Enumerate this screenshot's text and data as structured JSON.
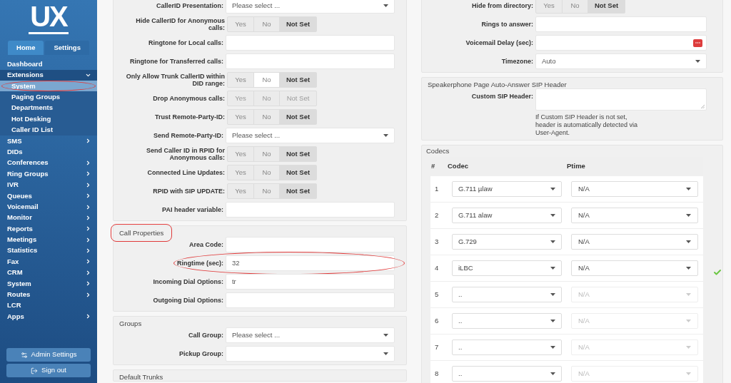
{
  "sidebar": {
    "logo": "UX",
    "tabs": [
      {
        "label": "Home",
        "selected": true
      },
      {
        "label": "Settings",
        "selected": false
      }
    ],
    "items": [
      {
        "label": "Dashboard",
        "selected": false,
        "has_arrow": false
      },
      {
        "label": "Extensions",
        "selected": false,
        "has_arrow": true,
        "expanded": true,
        "children": [
          {
            "label": "System",
            "selected": true
          },
          {
            "label": "Paging Groups",
            "selected": false
          },
          {
            "label": "Departments",
            "selected": false
          },
          {
            "label": "Hot Desking",
            "selected": false
          },
          {
            "label": "Caller ID List",
            "selected": false
          }
        ]
      },
      {
        "label": "SMS",
        "selected": false,
        "has_arrow": true
      },
      {
        "label": "DIDs",
        "selected": false,
        "has_arrow": false
      },
      {
        "label": "Conferences",
        "selected": false,
        "has_arrow": true
      },
      {
        "label": "Ring Groups",
        "selected": false,
        "has_arrow": true
      },
      {
        "label": "IVR",
        "selected": false,
        "has_arrow": true
      },
      {
        "label": "Queues",
        "selected": false,
        "has_arrow": true
      },
      {
        "label": "Voicemail",
        "selected": false,
        "has_arrow": true
      },
      {
        "label": "Monitor",
        "selected": false,
        "has_arrow": true
      },
      {
        "label": "Reports",
        "selected": false,
        "has_arrow": true
      },
      {
        "label": "Meetings",
        "selected": false,
        "has_arrow": true
      },
      {
        "label": "Statistics",
        "selected": false,
        "has_arrow": true
      },
      {
        "label": "Fax",
        "selected": false,
        "has_arrow": true
      },
      {
        "label": "CRM",
        "selected": false,
        "has_arrow": true
      },
      {
        "label": "System",
        "selected": false,
        "has_arrow": true
      },
      {
        "label": "Routes",
        "selected": false,
        "has_arrow": true
      },
      {
        "label": "LCR",
        "selected": false,
        "has_arrow": false
      },
      {
        "label": "Apps",
        "selected": false,
        "has_arrow": true
      }
    ],
    "buttons": [
      {
        "kind": "settings",
        "label": "Admin Settings"
      },
      {
        "kind": "signout",
        "label": "Sign out"
      }
    ]
  },
  "left_panels": [
    {
      "rows": [
        {
          "kind": "select",
          "label": "CallerID Presentation:",
          "value": "Please select ..."
        },
        {
          "kind": "toggle",
          "label": "Hide CallerID for Anonymous calls:",
          "disabled": false,
          "options": [
            {
              "label": "Yes",
              "selected": false,
              "hovered": false
            },
            {
              "label": "No",
              "selected": false,
              "hovered": false
            },
            {
              "label": "Not Set",
              "selected": true,
              "hovered": false
            }
          ]
        },
        {
          "kind": "input",
          "label": "Ringtone for Local calls:"
        },
        {
          "kind": "input",
          "label": "Ringtone for Transferred calls:"
        },
        {
          "kind": "toggle",
          "label": "Only Allow Trunk CallerID within DID range:",
          "disabled": false,
          "options": [
            {
              "label": "Yes",
              "selected": false,
              "hovered": false
            },
            {
              "label": "No",
              "selected": false,
              "hovered": true
            },
            {
              "label": "Not Set",
              "selected": true,
              "hovered": false
            }
          ]
        },
        {
          "kind": "toggle",
          "label": "Drop Anonymous calls:",
          "disabled": true,
          "options": [
            {
              "label": "Yes",
              "selected": false,
              "hovered": false
            },
            {
              "label": "No",
              "selected": false,
              "hovered": false
            },
            {
              "label": "Not Set",
              "selected": false,
              "hovered": false
            }
          ]
        },
        {
          "kind": "toggle",
          "label": "Trust Remote-Party-ID:",
          "disabled": false,
          "options": [
            {
              "label": "Yes",
              "selected": false,
              "hovered": false
            },
            {
              "label": "No",
              "selected": false,
              "hovered": false
            },
            {
              "label": "Not Set",
              "selected": true,
              "hovered": false
            }
          ]
        },
        {
          "kind": "select",
          "label": "Send Remote-Party-ID:",
          "value": "Please select ..."
        },
        {
          "kind": "toggle",
          "label": "Send Caller ID in RPID for Anonymous calls:",
          "disabled": false,
          "options": [
            {
              "label": "Yes",
              "selected": false,
              "hovered": false
            },
            {
              "label": "No",
              "selected": false,
              "hovered": false
            },
            {
              "label": "Not Set",
              "selected": true,
              "hovered": false
            }
          ]
        },
        {
          "kind": "toggle",
          "label": "Connected Line Updates:",
          "disabled": false,
          "options": [
            {
              "label": "Yes",
              "selected": false,
              "hovered": false
            },
            {
              "label": "No",
              "selected": false,
              "hovered": false
            },
            {
              "label": "Not Set",
              "selected": true,
              "hovered": false
            }
          ]
        },
        {
          "kind": "toggle",
          "label": "RPID with SIP UPDATE:",
          "disabled": false,
          "options": [
            {
              "label": "Yes",
              "selected": false,
              "hovered": false
            },
            {
              "label": "No",
              "selected": false,
              "hovered": false
            },
            {
              "label": "Not Set",
              "selected": true,
              "hovered": false
            }
          ]
        },
        {
          "kind": "input",
          "label": "PAI header variable:"
        }
      ]
    },
    {
      "title": "Call Properties",
      "title_circled": true,
      "rows": [
        {
          "kind": "input",
          "label": "Area Code:"
        },
        {
          "kind": "input",
          "label": "Ringtime (sec):",
          "value": "32",
          "circled": true
        },
        {
          "kind": "input",
          "label": "Incoming Dial Options:",
          "value": "tr"
        },
        {
          "kind": "input",
          "label": "Outgoing Dial Options:"
        }
      ]
    },
    {
      "title": "Groups",
      "rows": [
        {
          "kind": "select",
          "label": "Call Group:",
          "value": "Please select ..."
        },
        {
          "kind": "select",
          "label": "Pickup Group:"
        }
      ]
    },
    {
      "title": "Default Trunks"
    }
  ],
  "right_panels": [
    {
      "rows": [
        {
          "kind": "toggle",
          "label": "Hide from directory:",
          "disabled": false,
          "options": [
            {
              "label": "Yes",
              "selected": false,
              "hovered": false
            },
            {
              "label": "No",
              "selected": false,
              "hovered": false
            },
            {
              "label": "Not Set",
              "selected": true,
              "hovered": false
            }
          ]
        },
        {
          "kind": "input",
          "label": "Rings to answer:"
        },
        {
          "kind": "input_button",
          "label": "Voicemail Delay (sec):"
        },
        {
          "kind": "select",
          "label": "Timezone:",
          "value": "Auto"
        }
      ]
    },
    {
      "title": "Speakerphone Page Auto-Answer SIP Header",
      "rows": [
        {
          "kind": "textarea",
          "label": "Custom SIP Header:",
          "help": "If Custom SIP Header is not set, header is automatically detected via User-Agent."
        }
      ]
    }
  ],
  "codecs": {
    "title": "Codecs",
    "columns": [
      "#",
      "Codec",
      "Ptime"
    ],
    "rows": [
      {
        "number": "1",
        "codec": "G.711 µlaw",
        "ptime": "N/A",
        "ptime_disabled": false
      },
      {
        "number": "2",
        "codec": "G.711 alaw",
        "ptime": "N/A",
        "ptime_disabled": false
      },
      {
        "number": "3",
        "codec": "G.729",
        "ptime": "N/A",
        "ptime_disabled": false
      },
      {
        "number": "4",
        "codec": "iLBC",
        "ptime": "N/A",
        "ptime_disabled": false
      },
      {
        "number": "5",
        "codec": "..",
        "ptime": "N/A",
        "ptime_disabled": true
      },
      {
        "number": "6",
        "codec": "..",
        "ptime": "N/A",
        "ptime_disabled": true
      },
      {
        "number": "7",
        "codec": "..",
        "ptime": "N/A",
        "ptime_disabled": true
      },
      {
        "number": "8",
        "codec": "..",
        "ptime": "N/A",
        "ptime_disabled": true
      }
    ],
    "saved": true
  }
}
